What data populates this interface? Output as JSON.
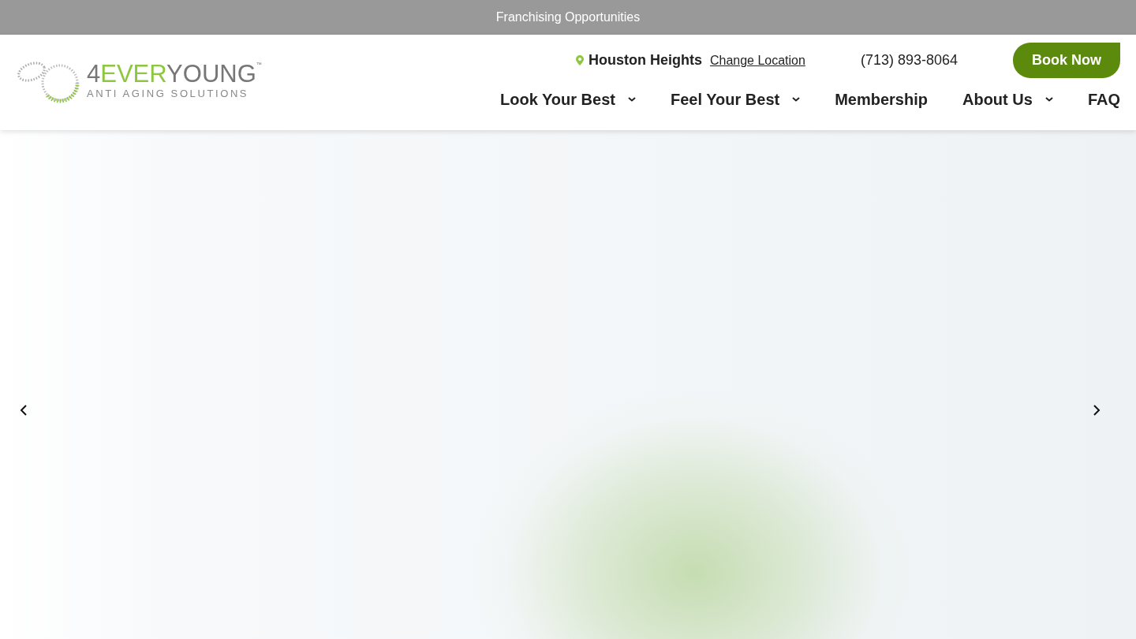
{
  "announcement_bar": {
    "text": "Franchising Opportunities"
  },
  "logo": {
    "wordmark": [
      {
        "text": "4",
        "accent": false
      },
      {
        "text": "EVER",
        "accent": true
      },
      {
        "text": "YOUNG",
        "accent": false
      }
    ],
    "trademark": "™",
    "tagline": "ANTI AGING SOLUTIONS"
  },
  "location": {
    "name": "Houston Heights",
    "change_link": "Change Location"
  },
  "phone": "(713) 893-8064",
  "book_button": "Book Now",
  "nav": [
    {
      "label": "Look Your Best",
      "has_dropdown": true
    },
    {
      "label": "Feel Your Best",
      "has_dropdown": true
    },
    {
      "label": "Membership",
      "has_dropdown": false
    },
    {
      "label": "About Us",
      "has_dropdown": true
    },
    {
      "label": "FAQ",
      "has_dropdown": false
    }
  ]
}
